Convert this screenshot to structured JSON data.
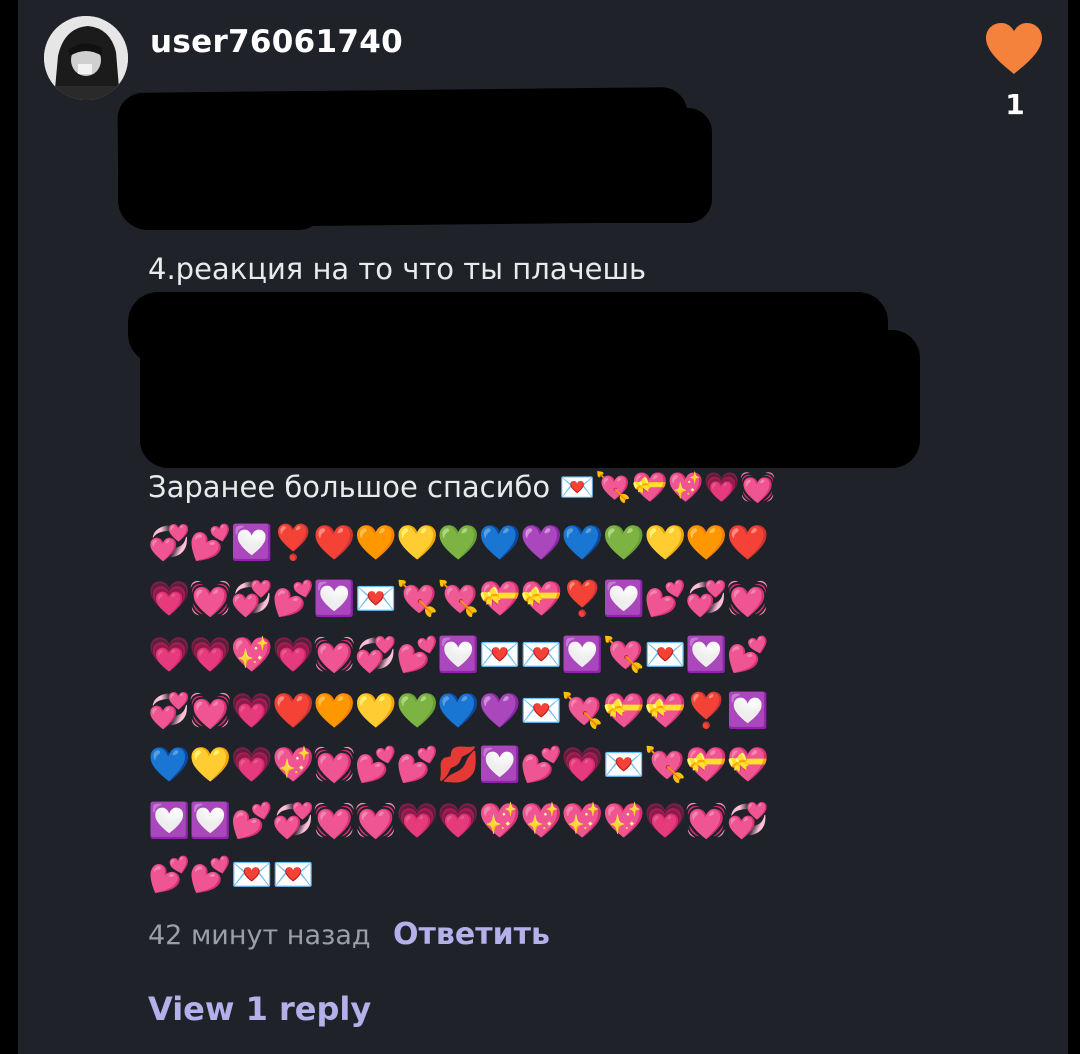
{
  "comment": {
    "username": "user76061740",
    "like_count": "1",
    "text_line_4": "4.реакция на то что ты плачешь",
    "thanks_line": "Заранее большое спасибо 💌💘💝💖💗💓",
    "emoji_rows": [
      "💞💕💟❣️❤️🧡💛💚💙💜💙💚💛🧡❤️",
      "💗💓💞💕💟💌💘💘💝💝❣️💟💕💞💓",
      "💗💗💖💗💓💞💕💟💌💌💟💘💌💟💕",
      "💞💓💗❤️🧡💛💚💙💜💌💘💝💝❣️💟",
      "💙💛💗💖💓💕💕💋💟💕💗💌💘💝💝",
      "💟💟💕💞💓💓💗💗💖💖💖💖💗💓💞",
      "💕💕💌💌"
    ],
    "timestamp": "42 минут назад",
    "reply_label": "Ответить",
    "view_replies_label": "View 1 reply"
  },
  "colors": {
    "background": "#1f2329",
    "like_heart": "#f4823c",
    "accent_link": "#b3b0ea",
    "muted_text": "#9aa0a8"
  },
  "icons": {
    "like": "heart-icon",
    "avatar": "user-avatar"
  }
}
